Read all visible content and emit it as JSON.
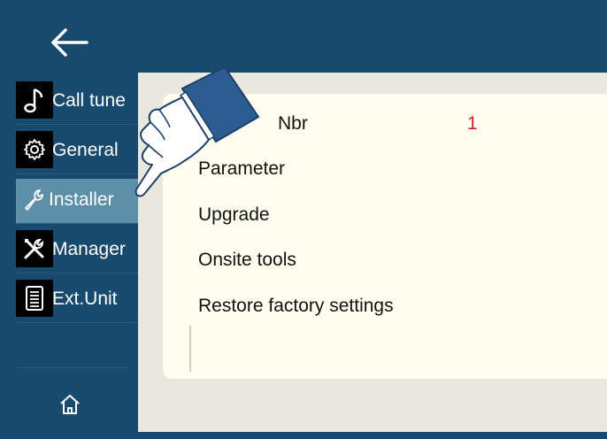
{
  "header": {
    "back_icon": "arrow-left-icon"
  },
  "sidebar": {
    "items": [
      {
        "label": "Call tune",
        "icon": "music-note-icon",
        "active": false
      },
      {
        "label": "General",
        "icon": "gear-icon",
        "active": false
      },
      {
        "label": "Installer",
        "icon": "wrench-icon",
        "active": true
      },
      {
        "label": "Manager",
        "icon": "tools-icon",
        "active": false
      },
      {
        "label": "Ext.Unit",
        "icon": "document-icon",
        "active": false
      }
    ],
    "home_icon": "home-icon"
  },
  "main": {
    "rows": [
      {
        "label": "Nbr",
        "value": "1"
      },
      {
        "label": "Parameter"
      },
      {
        "label": "Upgrade"
      },
      {
        "label": "Onsite tools"
      },
      {
        "label": "Restore factory settings"
      }
    ]
  },
  "colors": {
    "frame": "#174a6c",
    "active_item": "#5e8fa9",
    "content_bg": "#e9e8df",
    "panel_bg": "#fefef0",
    "value_red": "#d62020"
  },
  "overlay": {
    "pointer_icon": "pointing-hand-icon"
  }
}
